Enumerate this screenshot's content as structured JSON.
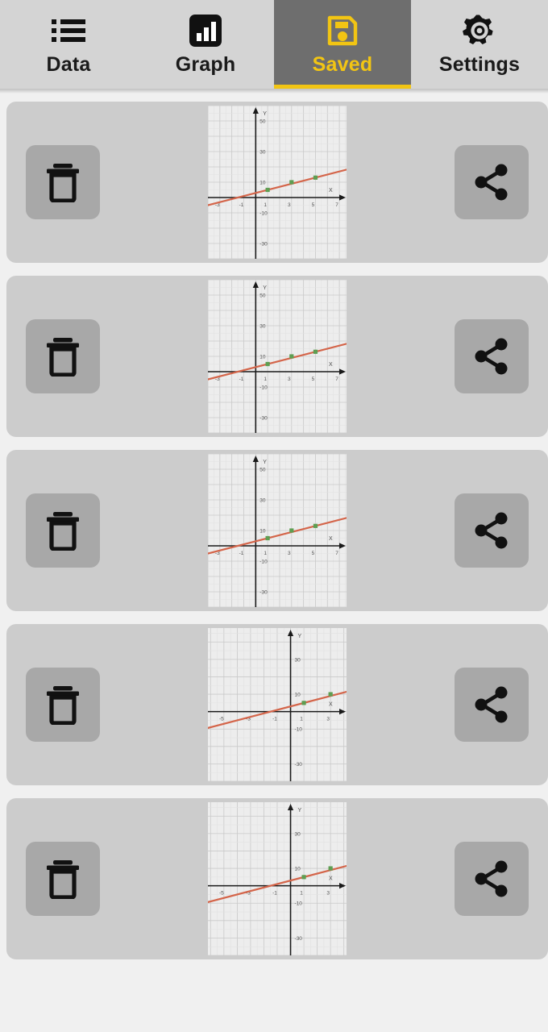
{
  "tabs": [
    {
      "label": "Data",
      "icon": "list-icon",
      "active": false
    },
    {
      "label": "Graph",
      "icon": "bar-chart-icon",
      "active": false
    },
    {
      "label": "Saved",
      "icon": "save-disk-icon",
      "active": true
    },
    {
      "label": "Settings",
      "icon": "gear-icon",
      "active": false
    }
  ],
  "theme": {
    "page_bg": "#f0f0f0",
    "tabbar_bg": "#d4d4d4",
    "active_tab_bg": "#6e6e6e",
    "accent": "#f2c513",
    "card_bg": "#cccccc",
    "button_bg": "#a8a8a8",
    "plot_bg": "#ededed",
    "line_color": "#d4654a",
    "point_color": "#5e9e52"
  },
  "buttons": {
    "delete_label": "delete",
    "delete_icon": "trash-icon",
    "share_label": "share",
    "share_icon": "share-icon"
  },
  "chart_data": [
    {
      "type": "scatter",
      "id": "saved-graph-1",
      "xlabel": "X",
      "ylabel": "Y",
      "x_ticks": [
        -3,
        -1,
        1,
        3,
        5,
        7
      ],
      "y_ticks": [
        50,
        30,
        10,
        -10,
        -30
      ],
      "xlim": [
        -4,
        7.6
      ],
      "ylim": [
        -40,
        60
      ],
      "grid": true,
      "points": [
        {
          "x": 1,
          "y": 5
        },
        {
          "x": 3,
          "y": 10
        },
        {
          "x": 5,
          "y": 13
        }
      ],
      "fit_line": {
        "slope": 2.0,
        "intercept": 3.0
      }
    },
    {
      "type": "scatter",
      "id": "saved-graph-2",
      "xlabel": "X",
      "ylabel": "Y",
      "x_ticks": [
        -3,
        -1,
        1,
        3,
        5,
        7
      ],
      "y_ticks": [
        50,
        30,
        10,
        -10,
        -30
      ],
      "xlim": [
        -4,
        7.6
      ],
      "ylim": [
        -40,
        60
      ],
      "grid": true,
      "points": [
        {
          "x": 1,
          "y": 5
        },
        {
          "x": 3,
          "y": 10
        },
        {
          "x": 5,
          "y": 13
        }
      ],
      "fit_line": {
        "slope": 2.0,
        "intercept": 3.0
      }
    },
    {
      "type": "scatter",
      "id": "saved-graph-3",
      "xlabel": "X",
      "ylabel": "Y",
      "x_ticks": [
        -3,
        -1,
        1,
        3,
        5,
        7
      ],
      "y_ticks": [
        50,
        30,
        10,
        -10,
        -30
      ],
      "xlim": [
        -4,
        7.6
      ],
      "ylim": [
        -40,
        60
      ],
      "grid": true,
      "points": [
        {
          "x": 1,
          "y": 5
        },
        {
          "x": 3,
          "y": 10
        },
        {
          "x": 5,
          "y": 13
        }
      ],
      "fit_line": {
        "slope": 2.0,
        "intercept": 3.0
      }
    },
    {
      "type": "scatter",
      "id": "saved-graph-4",
      "xlabel": "X",
      "ylabel": "Y",
      "x_ticks": [
        -5,
        -3,
        -1,
        1,
        3
      ],
      "y_ticks": [
        30,
        10,
        -10,
        -30
      ],
      "xlim": [
        -6.2,
        4.2
      ],
      "ylim": [
        -40,
        48
      ],
      "grid": true,
      "points": [
        {
          "x": 1,
          "y": 5
        },
        {
          "x": 3,
          "y": 10
        }
      ],
      "fit_line": {
        "slope": 2.0,
        "intercept": 3.0
      }
    },
    {
      "type": "scatter",
      "id": "saved-graph-5",
      "xlabel": "X",
      "ylabel": "Y",
      "x_ticks": [
        -5,
        -3,
        -1,
        1,
        3
      ],
      "y_ticks": [
        30,
        10,
        -10,
        -30
      ],
      "xlim": [
        -6.2,
        4.2
      ],
      "ylim": [
        -40,
        48
      ],
      "grid": true,
      "points": [
        {
          "x": 1,
          "y": 5
        },
        {
          "x": 3,
          "y": 10
        }
      ],
      "fit_line": {
        "slope": 2.0,
        "intercept": 3.0
      }
    }
  ]
}
